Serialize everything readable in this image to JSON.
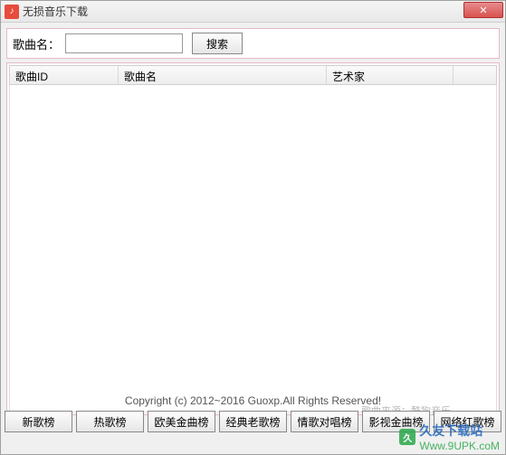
{
  "window": {
    "title": "无损音乐下载",
    "icon": "music-icon"
  },
  "search": {
    "label": "歌曲名：",
    "value": "",
    "placeholder": "",
    "button": "搜索"
  },
  "columns": {
    "id": "歌曲ID",
    "name": "歌曲名",
    "artist": "艺术家",
    "extra": ""
  },
  "rows": [],
  "copyright": "Copyright (c)  2012~2016 Guoxp.All Rights Reserved!",
  "source_label": "歌曲来源：酷狗音乐",
  "charts": {
    "new": "新歌榜",
    "hot": "热歌榜",
    "western": "欧美金曲榜",
    "classic": "经典老歌榜",
    "love": "情歌对唱榜",
    "filmtv": "影视金曲榜",
    "net": "网络红歌榜"
  },
  "watermark": {
    "site_cn": "久友下载站",
    "site_url": "Www.9UPK.coM"
  }
}
